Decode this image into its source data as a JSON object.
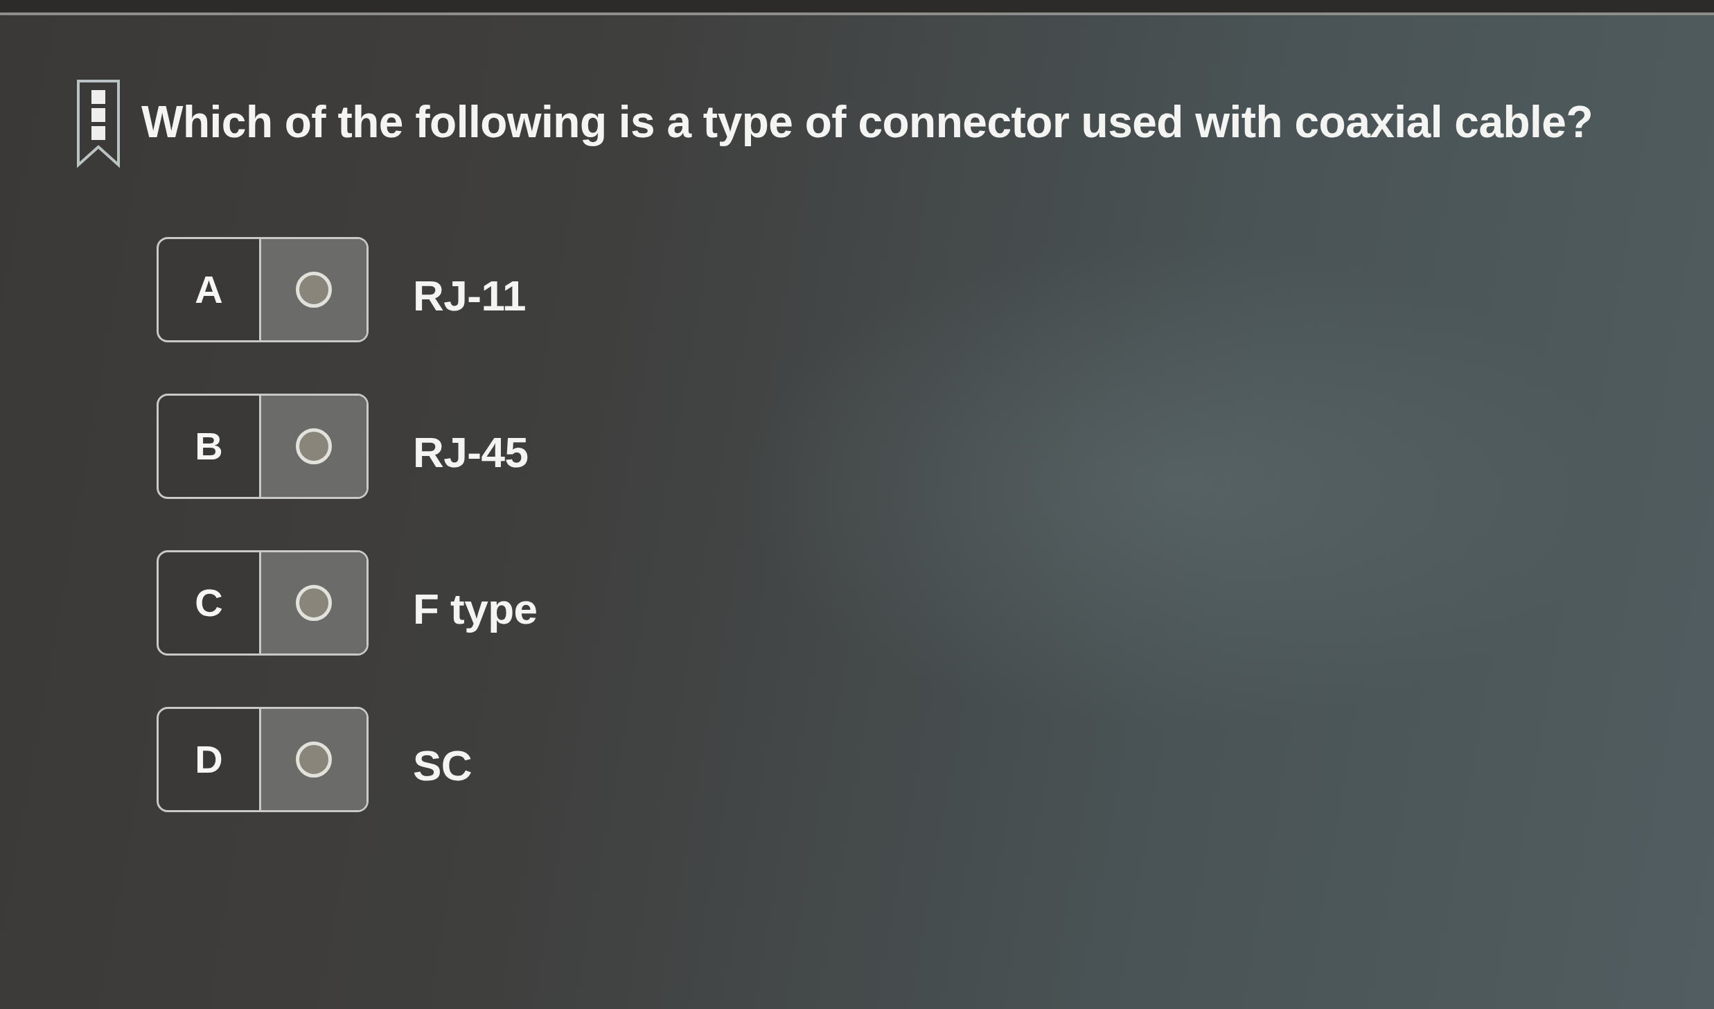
{
  "question": {
    "text": "Which of the following is a type of connector used with coaxial cable?"
  },
  "options": [
    {
      "letter": "A",
      "text": "RJ-11",
      "selected": false
    },
    {
      "letter": "B",
      "text": "RJ-45",
      "selected": false
    },
    {
      "letter": "C",
      "text": "F type",
      "selected": false
    },
    {
      "letter": "D",
      "text": "SC",
      "selected": false
    }
  ]
}
